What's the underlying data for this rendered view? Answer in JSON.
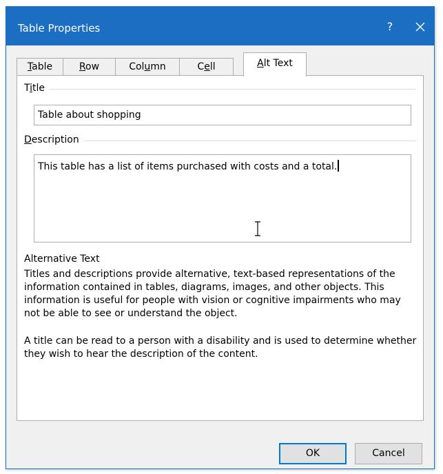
{
  "dialog": {
    "title": "Table Properties",
    "help_label": "?",
    "close_icon": "close-icon",
    "accent_color": "#1b6ec2"
  },
  "tabs": [
    {
      "label": "Table",
      "mnemonic_index": 0,
      "active": false
    },
    {
      "label": "Row",
      "mnemonic_index": 0,
      "active": false
    },
    {
      "label": "Column",
      "mnemonic_index": 3,
      "active": false
    },
    {
      "label": "Cell",
      "mnemonic_index": 1,
      "active": false
    },
    {
      "label": "Alt Text",
      "mnemonic_index": 0,
      "active": true
    }
  ],
  "alt_text": {
    "title_label": "Title",
    "title_value": "Table about shopping",
    "description_label": "Description",
    "description_value": "This table has a list of items purchased with costs and a total.",
    "info_heading": "Alternative Text",
    "info_paragraph_1": "Titles and descriptions provide alternative, text-based representations of the information contained in tables, diagrams, images, and other objects. This information is useful for people with vision or cognitive impairments who may not be able to see or understand the object.",
    "info_paragraph_2": "A title can be read to a person with a disability and is used to determine whether they wish to hear the description of the content."
  },
  "buttons": {
    "ok_label": "OK",
    "cancel_label": "Cancel"
  }
}
